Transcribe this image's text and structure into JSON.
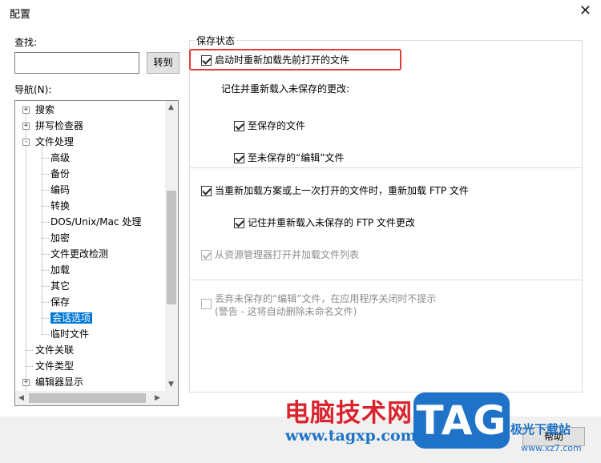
{
  "window": {
    "title": "配置",
    "close_glyph": "✕"
  },
  "find": {
    "label": "查找:",
    "value": "",
    "button": "转到"
  },
  "nav": {
    "label": "导航(N):",
    "items": [
      {
        "label": "搜索",
        "level": 0,
        "expander": "+"
      },
      {
        "label": "拼写检查器",
        "level": 0,
        "expander": "+"
      },
      {
        "label": "文件处理",
        "level": 0,
        "expander": "-"
      },
      {
        "label": "高级",
        "level": 1
      },
      {
        "label": "备份",
        "level": 1
      },
      {
        "label": "编码",
        "level": 1
      },
      {
        "label": "转换",
        "level": 1
      },
      {
        "label": "DOS/Unix/Mac 处理",
        "level": 1
      },
      {
        "label": "加密",
        "level": 1
      },
      {
        "label": "文件更改检测",
        "level": 1
      },
      {
        "label": "加载",
        "level": 1
      },
      {
        "label": "其它",
        "level": 1
      },
      {
        "label": "保存",
        "level": 1
      },
      {
        "label": "会话选项",
        "level": 1,
        "selected": true
      },
      {
        "label": "临时文件",
        "level": 1
      },
      {
        "label": "文件关联",
        "level": 0
      },
      {
        "label": "文件类型",
        "level": 0
      },
      {
        "label": "编辑器显示",
        "level": 0,
        "expander": "+"
      }
    ]
  },
  "save_state": {
    "title": "保存状态",
    "reload_on_start": {
      "label": "启动时重新加载先前打开的文件",
      "checked": true
    },
    "remember_text": "记住并重新载入未保存的更改:",
    "to_saved": {
      "label": "至保存的文件",
      "checked": true
    },
    "to_unsaved": {
      "label": "至未保存的“编辑”文件",
      "checked": true
    },
    "reload_ftp": {
      "label": "当重新加载方案或上一次打开的文件时，重新加载 FTP 文件",
      "checked": true
    },
    "remember_ftp": {
      "label": "记住并重新载入未保存的 FTP 文件更改",
      "checked": true
    },
    "explorer_list": {
      "label": "从资源管理器打开并加载文件列表",
      "checked": true,
      "disabled": true
    },
    "discard_unsaved": {
      "label_line1": "丢弃未保存的“编辑”文件，在应用程序关闭时不提示",
      "label_line2": "(警告 - 这将自动删除未命名文件)",
      "checked": false,
      "disabled": true
    }
  },
  "footer": {
    "help_button": "帮助"
  },
  "watermark": {
    "brand_cn": "电脑技术网",
    "url": "www.tagxp.com",
    "tag": "TAG",
    "site_cn": "极光下载站",
    "site_url": "www.xz7.com"
  },
  "colors": {
    "selection": "#0078d7",
    "highlight_box": "#e23b3b",
    "watermark_red": "#d9232d",
    "watermark_blue": "#1e73c8"
  }
}
